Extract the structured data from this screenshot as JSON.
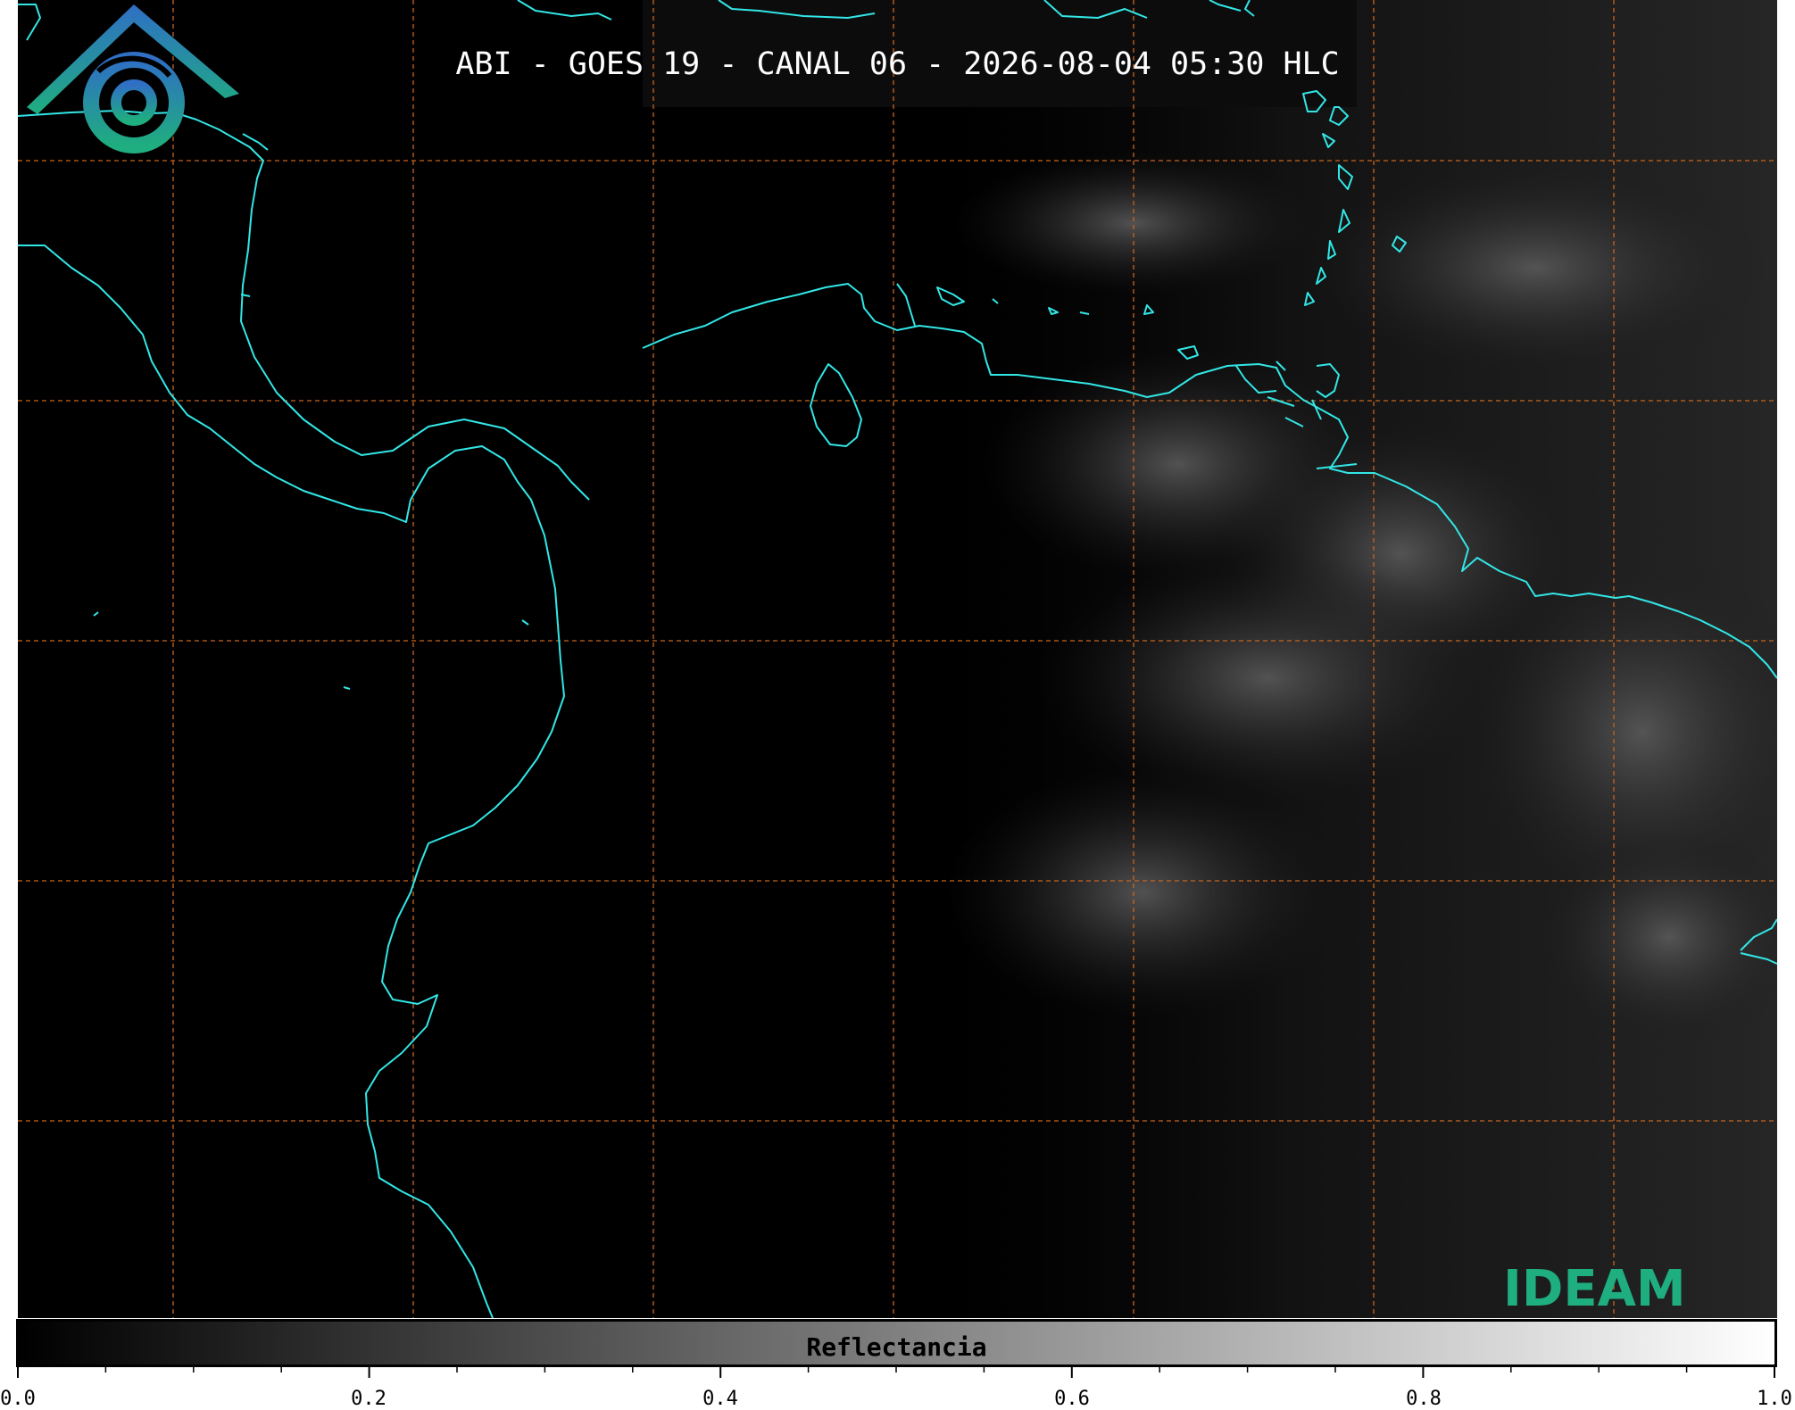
{
  "title": "ABI - GOES 19 - CANAL 06 - 2026-08-04 05:30 HLC",
  "colors": {
    "background": "#000000",
    "coastline": "#33e6e6",
    "gridlines": "#c8651e",
    "logo_blue": "#2f7fc1",
    "logo_green": "#1fae7f"
  },
  "map": {
    "gridlines": "dashed",
    "coastline_icon": "coastline-outline"
  },
  "logo": {
    "text": "IDEAM",
    "icon": "ideam-mountain-swirl-icon"
  },
  "colorbar": {
    "label": "Reflectancia",
    "colormap": "grayscale black-to-white",
    "range": [
      0.0,
      1.0
    ],
    "tick_labels": [
      "0.0",
      "0.2",
      "0.4",
      "0.6",
      "0.8",
      "1.0"
    ],
    "tick_values": [
      0.0,
      0.2,
      0.4,
      0.6,
      0.8,
      1.0
    ]
  }
}
